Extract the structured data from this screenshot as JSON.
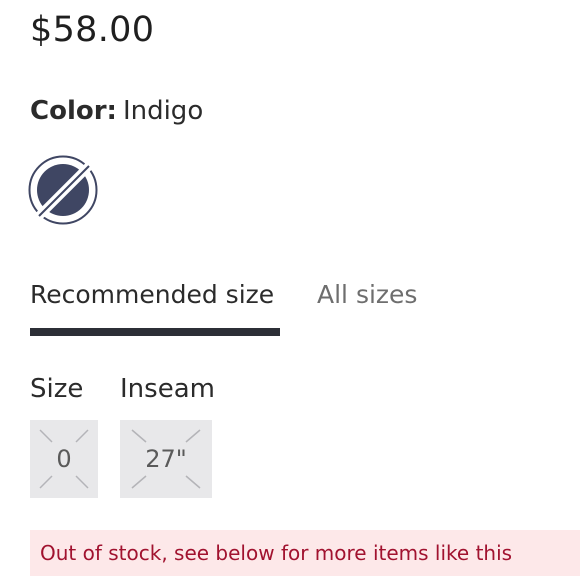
{
  "product": {
    "price": "$58.00"
  },
  "color": {
    "label": "Color:",
    "value": "Indigo",
    "swatch_hex": "#3f4663",
    "unavailable": true
  },
  "size_tabs": [
    {
      "label": "Recommended size",
      "active": true
    },
    {
      "label": "All sizes",
      "active": false
    }
  ],
  "size_selector": {
    "size_label": "Size",
    "inseam_label": "Inseam",
    "size_option": "0",
    "inseam_option": "27\"",
    "options_unavailable": true
  },
  "stock_message": "Out of stock, see below for more items like this",
  "colors": {
    "text": "#2b2b2b",
    "tab_inactive": "#6e6e6e",
    "tab_underline": "#2c2f36",
    "option_bg": "#e8e8ea",
    "banner_bg": "#fde8e9",
    "banner_text": "#a1122f"
  }
}
